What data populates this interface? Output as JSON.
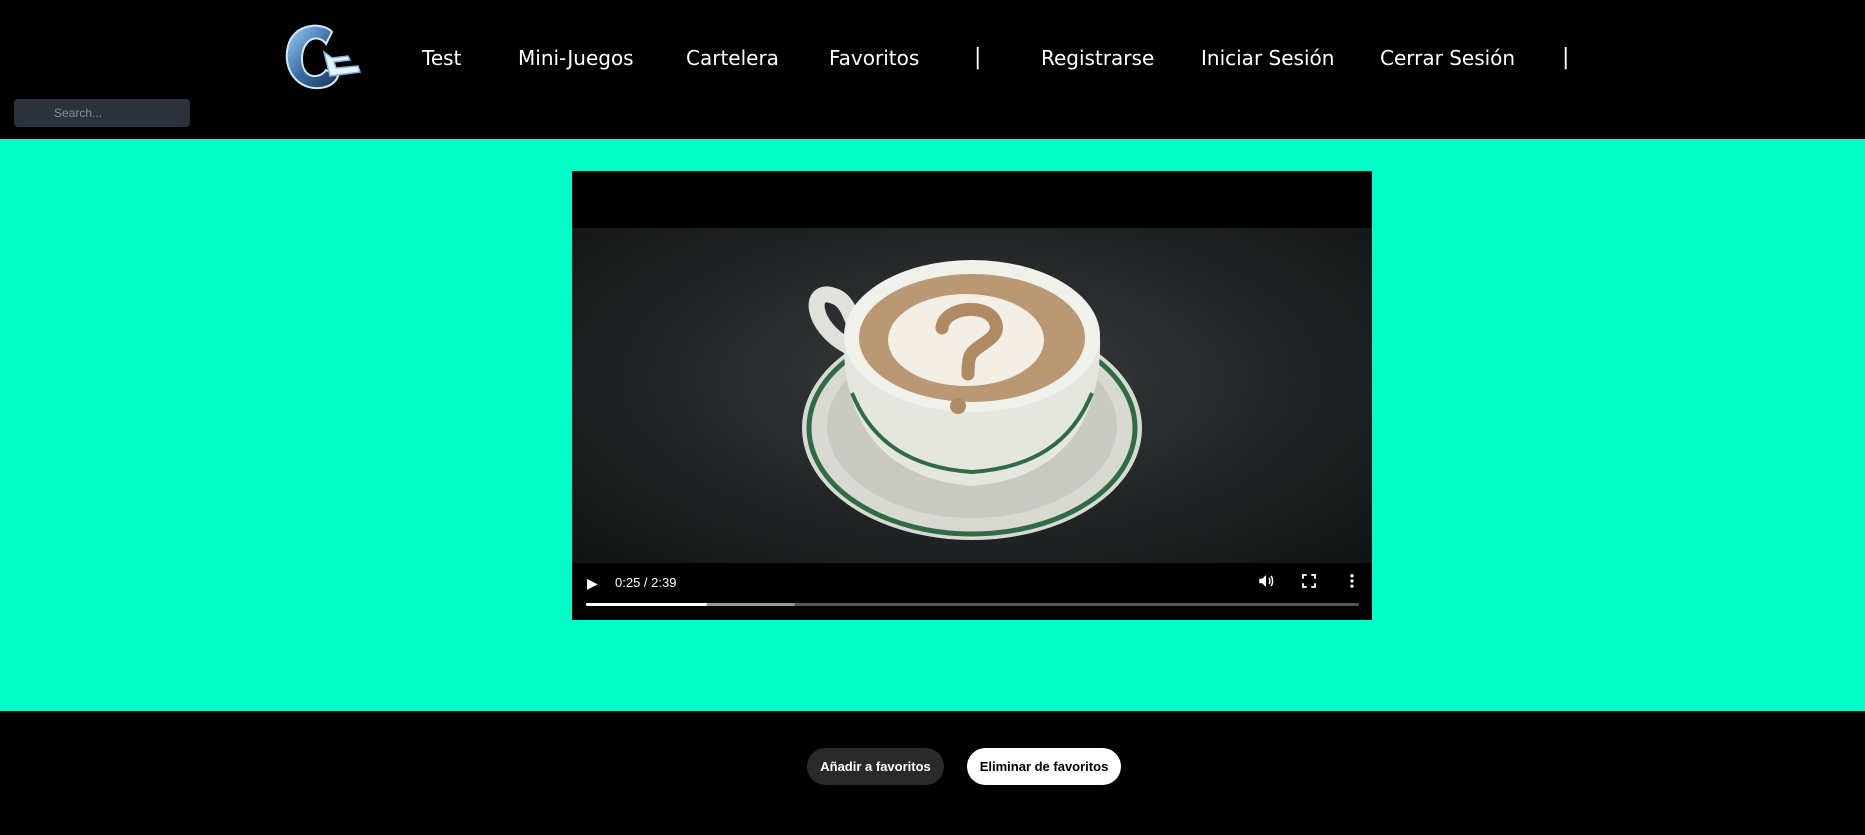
{
  "header": {
    "logo_text": "CL",
    "nav": [
      {
        "label": "Test"
      },
      {
        "label": "Mini-Juegos"
      },
      {
        "label": "Cartelera"
      },
      {
        "label": "Favoritos"
      },
      {
        "label": "|"
      },
      {
        "label": "Registrarse"
      },
      {
        "label": "Iniciar Sesión"
      },
      {
        "label": "Cerrar Sesión"
      },
      {
        "label": "|"
      }
    ],
    "search": {
      "placeholder": "Search..."
    }
  },
  "main": {
    "background_color": "#00ffc8",
    "video": {
      "time_display": "0:25 / 2:39",
      "progress": 0.157,
      "buffered": 0.27,
      "icons": [
        "play-icon",
        "volume-icon",
        "fullscreen-icon",
        "more-options-icon"
      ]
    }
  },
  "footer": {
    "add_favorites_label": "Añadir a favoritos",
    "remove_favorites_label": "Eliminar de favoritos"
  }
}
